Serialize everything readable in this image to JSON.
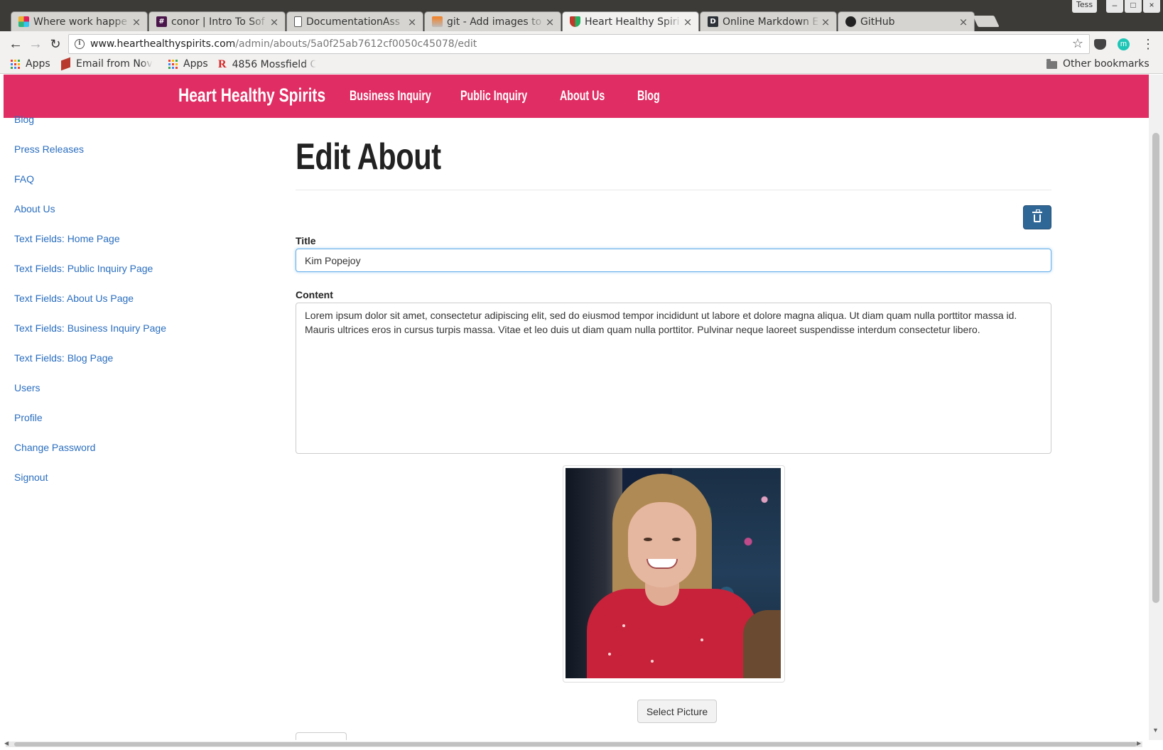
{
  "browser": {
    "tabs": [
      {
        "title": "Where work happe",
        "icon": "slack-icon",
        "close": "×"
      },
      {
        "title": "conor | Intro To Sof",
        "icon": "slack-hash-icon",
        "close": "×"
      },
      {
        "title": "DocumentationAss",
        "icon": "document-icon",
        "close": "×"
      },
      {
        "title": "git - Add images to",
        "icon": "stackoverflow-icon",
        "close": "×"
      },
      {
        "title": "Heart Healthy Spiri",
        "icon": "shield-icon",
        "close": "×"
      },
      {
        "title": "Online Markdown E",
        "icon": "dillinger-icon",
        "close": "×"
      },
      {
        "title": "GitHub",
        "icon": "github-icon",
        "close": "×"
      }
    ],
    "window_user": "Tess",
    "window_controls": {
      "minimize": "–",
      "maximize": "□",
      "close": "×"
    },
    "url_host": "www.hearthealthyspirits.com",
    "url_path": "/admin/abouts/5a0f25ab7612cf0050c45078/edit",
    "ext_m_label": "m",
    "bookmarks": [
      {
        "label": "Apps",
        "icon": "apps-grid-icon"
      },
      {
        "label": "Email from Nov",
        "icon": "bookmark-red-icon"
      },
      {
        "label": "Apps",
        "icon": "apps-grid-icon"
      },
      {
        "label": "4856 Mossfield C",
        "icon": "r-logo-icon"
      },
      {
        "label": "Other bookmarks",
        "icon": "folder-icon"
      }
    ],
    "bookmark_r": "R"
  },
  "site": {
    "brand": "Heart Healthy Spirits",
    "nav": [
      "Business Inquiry",
      "Public Inquiry",
      "About Us",
      "Blog"
    ],
    "brand_color": "#e02d63"
  },
  "sidebar": {
    "items": [
      "Blog",
      "Press Releases",
      "FAQ",
      "About Us",
      "Text Fields: Home Page",
      "Text Fields: Public Inquiry Page",
      "Text Fields: About Us Page",
      "Text Fields: Business Inquiry Page",
      "Text Fields: Blog Page",
      "Users",
      "Profile",
      "Change Password",
      "Signout"
    ]
  },
  "form": {
    "heading": "Edit About",
    "title_label": "Title",
    "title_value": "Kim Popejoy",
    "content_label": "Content",
    "content_value": "Lorem ipsum dolor sit amet, consectetur adipiscing elit, sed do eiusmod tempor incididunt ut labore et dolore magna aliqua. Ut diam quam nulla porttitor massa id. Mauris ultrices eros in cursus turpis massa. Vitae et leo duis ut diam quam nulla porttitor. Pulvinar neque laoreet suspendisse interdum consectetur libero.",
    "select_picture_label": "Select Picture",
    "delete_icon": "trash-icon"
  }
}
